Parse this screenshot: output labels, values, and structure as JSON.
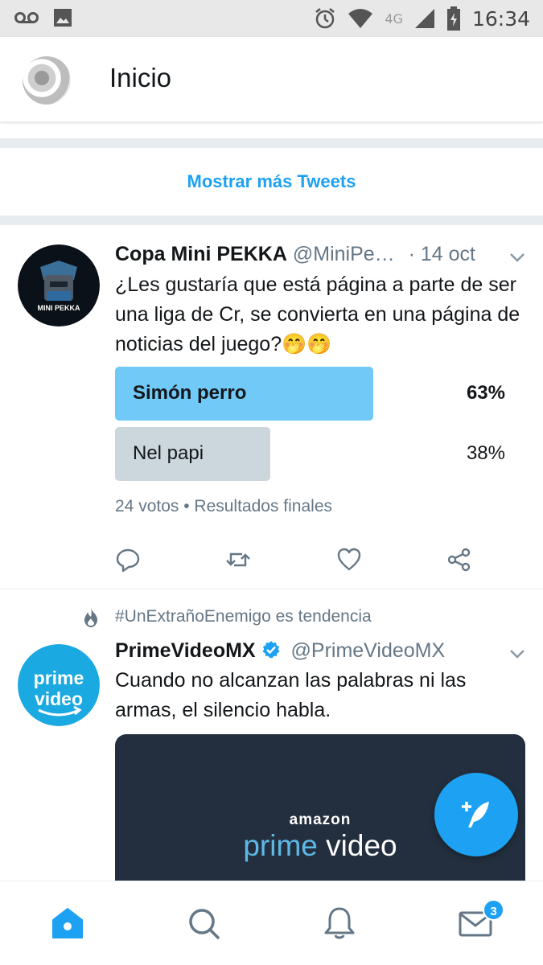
{
  "status_bar": {
    "time": "16:34",
    "network": "4G",
    "icons": [
      "voicemail-icon",
      "image-icon",
      "alarm-icon",
      "wifi-icon",
      "signal-icon",
      "battery-icon"
    ]
  },
  "header": {
    "title": "Inicio"
  },
  "load_more": {
    "label": "Mostrar más Tweets"
  },
  "tweet1": {
    "name": "Copa Mini PEKKA",
    "handle": "@MiniPe…",
    "date": "· 14 oct",
    "avatar_text": "MINI PEKKA",
    "text": "¿Les gustaría que está página a parte de ser una liga de Cr, se convierta en una página de noticias del juego?🤭🤭",
    "poll": {
      "options": [
        {
          "label": "Simón perro",
          "percent": "63%",
          "share": 0.63,
          "winner": true
        },
        {
          "label": "Nel papi",
          "percent": "38%",
          "share": 0.38,
          "winner": false
        }
      ],
      "meta": "24 votos • Resultados finales"
    }
  },
  "tweet2": {
    "social_context": "#UnExtrañoEnemigo es tendencia",
    "name": "PrimeVideoMX",
    "handle": "@PrimeVideoMX",
    "avatar_text_top": "prime",
    "avatar_text_bottom": "video",
    "text": "Cuando no alcanzan las palabras ni las armas, el silencio habla.",
    "media": {
      "brand_top": "amazon",
      "brand_prime": "prime",
      "brand_video": "video"
    }
  },
  "tab_bar": {
    "messages_badge": "3"
  },
  "colors": {
    "accent": "#1da1f2",
    "poll_winner": "#71c9f8",
    "poll_other": "#ccd6dd",
    "secondary_text": "#657786"
  }
}
